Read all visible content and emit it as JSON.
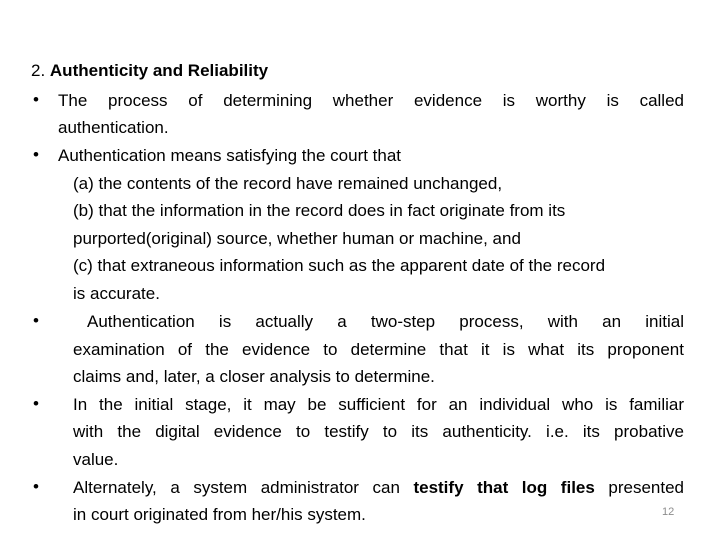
{
  "slide": {
    "heading": {
      "number": "2. ",
      "title": "Authenticity and Reliability"
    },
    "bullets": [
      {
        "lines": [
          "The process of determining whether evidence is worthy is called",
          "authentication."
        ]
      },
      {
        "lines": [
          "Authentication means satisfying the court that"
        ],
        "sub_items": [
          {
            "lines": [
              "(a) the contents of the record have remained unchanged,"
            ]
          },
          {
            "lines": [
              "(b) that the information in the record does in fact originate from its",
              "purported(original) source, whether human or machine, and"
            ]
          },
          {
            "lines": [
              "(c) that extraneous information such as the apparent date of the record",
              "is accurate."
            ]
          }
        ]
      },
      {
        "lines": [
          "Authentication is actually a two-step process, with an initial",
          "examination of the evidence to determine that it is what its proponent",
          "claims and, later, a closer analysis to determine."
        ]
      },
      {
        "lines": [
          "In the initial stage, it may be sufficient for an individual who is familiar",
          "with the digital evidence to testify to its authenticity. i.e. its probative",
          "value."
        ]
      },
      {
        "line1_prefix": "Alternately, a system administrator can ",
        "line1_bold": "testify that log files",
        "line1_suffix": " presented",
        "line2": "in court originated from her/his system."
      }
    ],
    "bullet_glyph": "•",
    "page_number": "12"
  },
  "colors": {
    "background": "#ffffff",
    "text": "#000000",
    "page_number": "#8c8c8c"
  }
}
